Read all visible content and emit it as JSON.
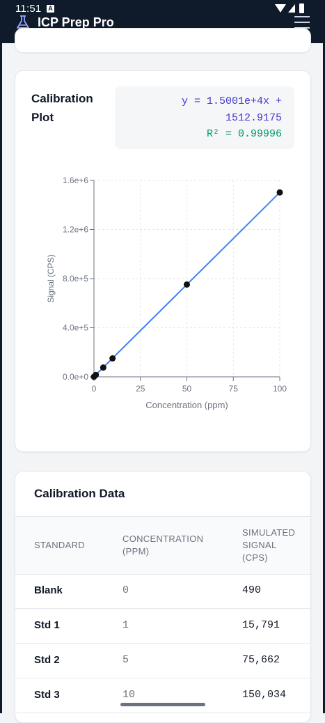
{
  "status": {
    "time": "11:51",
    "indicator": "A"
  },
  "app": {
    "title": "ICP Prep Pro",
    "icon": "flask-icon",
    "menu_icon": "hamburger-menu-icon"
  },
  "plot_card": {
    "title": "Calibration Plot",
    "equation": "y = 1.5001e+4x + 1512.9175",
    "r_squared": "R² = 0.99996"
  },
  "chart_data": {
    "type": "scatter",
    "title": "",
    "xlabel": "Concentration (ppm)",
    "ylabel": "Signal (CPS)",
    "xlim": [
      0,
      100
    ],
    "ylim": [
      0,
      1600000
    ],
    "x_ticks": [
      0,
      25,
      50,
      75,
      100
    ],
    "y_ticks": [
      0,
      400000,
      800000,
      1200000,
      1600000
    ],
    "x_tick_labels": [
      "0",
      "25",
      "50",
      "75",
      "100"
    ],
    "y_tick_labels": [
      "0.0e+0",
      "4.0e+5",
      "8.0e+5",
      "1.2e+6",
      "1.6e+6"
    ],
    "grid": true,
    "points": [
      {
        "x": 0,
        "y": 490
      },
      {
        "x": 1,
        "y": 15791
      },
      {
        "x": 5,
        "y": 75662
      },
      {
        "x": 10,
        "y": 150034
      },
      {
        "x": 50,
        "y": 752000
      },
      {
        "x": 100,
        "y": 1502000
      }
    ],
    "fit_line": {
      "slope": 15001,
      "intercept": 1512.9175
    },
    "colors": {
      "line": "#3b82f6",
      "points": "#111111",
      "grid": "#e5e7eb"
    }
  },
  "data_card": {
    "title": "Calibration Data",
    "headers": {
      "standard": "STANDARD",
      "conc_line1": "CONCENTRATION",
      "conc_line2": "(PPM)",
      "sig_line1": "SIMULATED",
      "sig_line2": "SIGNAL",
      "sig_line3": "(CPS)"
    },
    "rows": [
      {
        "standard": "Blank",
        "concentration": "0",
        "signal": "490"
      },
      {
        "standard": "Std 1",
        "concentration": "1",
        "signal": "15,791"
      },
      {
        "standard": "Std 2",
        "concentration": "5",
        "signal": "75,662"
      },
      {
        "standard": "Std 3",
        "concentration": "10",
        "signal": "150,034"
      }
    ]
  }
}
